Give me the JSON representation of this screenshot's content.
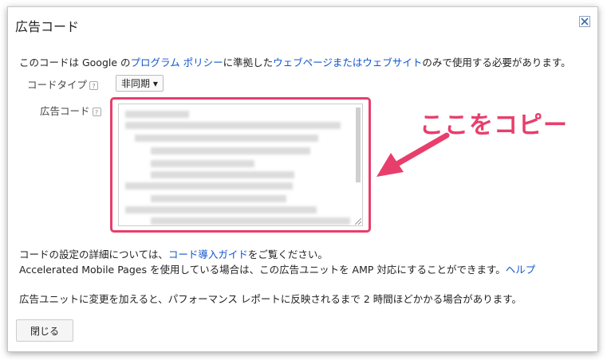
{
  "dialog": {
    "title": "広告コード",
    "intro": {
      "prefix": "このコードは Google の",
      "link_policy": "プログラム ポリシー",
      "mid": "に準拠した",
      "link_pages": "ウェブページまたはウェブサイト",
      "suffix": "のみで使用する必要があります。"
    },
    "code_type_label": "コードタイプ",
    "code_type_value": "非同期 ▾",
    "ad_code_label": "広告コード",
    "help_glyph": "?",
    "annotation": "ここをコピー",
    "details": {
      "prefix": "コードの設定の詳細については、",
      "link": "コード導入ガイド",
      "suffix": "をご覧ください。"
    },
    "amp": {
      "text": "Accelerated Mobile Pages を使用している場合は、この広告ユニットを AMP 対応にすることができます。",
      "link": "ヘルプ"
    },
    "notice": "広告ユニットに変更を加えると、パフォーマンス レポートに反映されるまで 2 時間ほどかかる場合があります。",
    "close_button": "閉じる"
  },
  "colors": {
    "accent": "#e83e6c",
    "link": "#1155cc"
  }
}
